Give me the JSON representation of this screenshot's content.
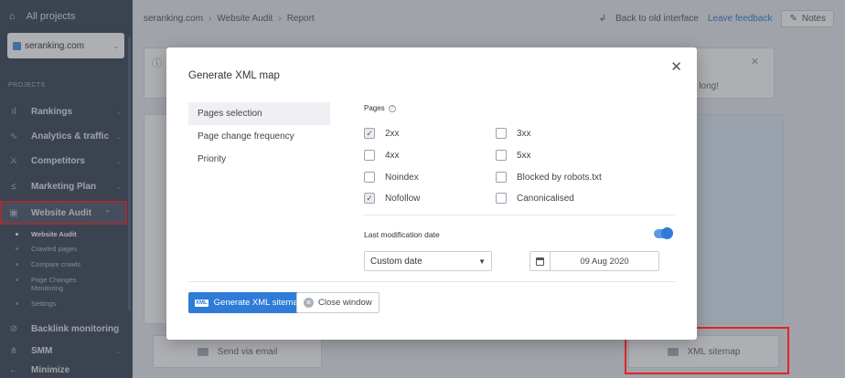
{
  "sidebar": {
    "all_projects": "All projects",
    "project": "seranking.com",
    "section_label": "PROJECTS",
    "items": [
      {
        "label": "Rankings",
        "icon": "bar-chart-icon"
      },
      {
        "label": "Analytics & traffic",
        "icon": "pulse-icon"
      },
      {
        "label": "Competitors",
        "icon": "competitors-icon"
      },
      {
        "label": "Marketing Plan",
        "icon": "marketing-icon"
      },
      {
        "label": "Website Audit",
        "icon": "audit-icon"
      },
      {
        "label": "Backlink monitoring",
        "icon": "link-icon"
      },
      {
        "label": "SMM",
        "icon": "share-icon"
      },
      {
        "label": "Minimize",
        "icon": "arrow-left-icon"
      }
    ],
    "sub_items": [
      "Website Audit",
      "Crawled pages",
      "Compare crawls",
      "Page Changes Monitoring",
      "Settings"
    ]
  },
  "topbar": {
    "crumb1": "seranking.com",
    "crumb2": "Website Audit",
    "crumb3": "Report",
    "back": "Back to old interface",
    "feedback": "Leave feedback",
    "notes": "Notes"
  },
  "background": {
    "notice_text": "ce long!",
    "send_email": "Send via email",
    "xml_sitemap": "XML sitemap"
  },
  "modal": {
    "title": "Generate XML map",
    "nav": [
      "Pages selection",
      "Page change frequency",
      "Priority"
    ],
    "pages_label": "Pages",
    "checkboxes": [
      {
        "label": "2xx",
        "checked": true
      },
      {
        "label": "3xx",
        "checked": false
      },
      {
        "label": "4xx",
        "checked": false
      },
      {
        "label": "5xx",
        "checked": false
      },
      {
        "label": "Noindex",
        "checked": false
      },
      {
        "label": "Blocked by robots.txt",
        "checked": false
      },
      {
        "label": "Nofollow",
        "checked": true
      },
      {
        "label": "Canonicalised",
        "checked": false
      }
    ],
    "last_mod_label": "Last modification date",
    "select_value": "Custom date",
    "date_value": "09 Aug 2020",
    "generate_btn": "Generate XML sitemap",
    "generate_icon_text": "XML",
    "close_btn": "Close window"
  }
}
